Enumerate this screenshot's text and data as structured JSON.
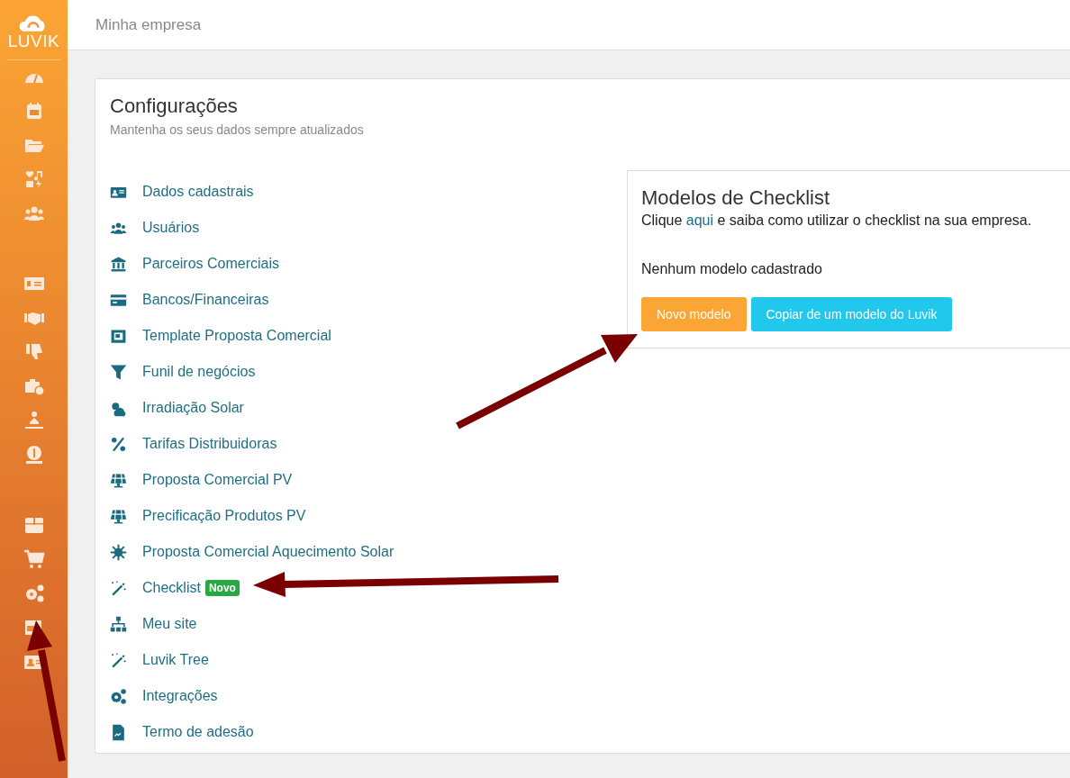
{
  "header": {
    "title": "Minha empresa"
  },
  "settings": {
    "title": "Configurações",
    "subtitle": "Mantenha os seus dados sempre atualizados",
    "items": [
      {
        "label": "Dados cadastrais"
      },
      {
        "label": "Usuários"
      },
      {
        "label": "Parceiros Comerciais"
      },
      {
        "label": "Bancos/Financeiras"
      },
      {
        "label": "Template Proposta Comercial"
      },
      {
        "label": "Funil de negócios"
      },
      {
        "label": "Irradiação Solar"
      },
      {
        "label": "Tarifas Distribuidoras"
      },
      {
        "label": "Proposta Comercial PV"
      },
      {
        "label": "Precificação Produtos PV"
      },
      {
        "label": "Proposta Comercial Aquecimento Solar"
      },
      {
        "label": "Checklist",
        "badge": "Novo"
      },
      {
        "label": "Meu site"
      },
      {
        "label": "Luvik Tree"
      },
      {
        "label": "Integrações"
      },
      {
        "label": "Termo de adesão"
      }
    ]
  },
  "checklist_panel": {
    "title": "Modelos de Checklist",
    "help_before": "Clique",
    "help_link": "aqui",
    "help_after": "e saiba como utilizar o checklist na sua empresa.",
    "empty_message": "Nenhum modelo cadastrado",
    "buttons": [
      {
        "label": "Novo modelo",
        "kind": "primary"
      },
      {
        "label": "Copiar de um modelo do Luvik",
        "kind": "info"
      }
    ]
  },
  "logo": {
    "text": "LUVIK"
  }
}
